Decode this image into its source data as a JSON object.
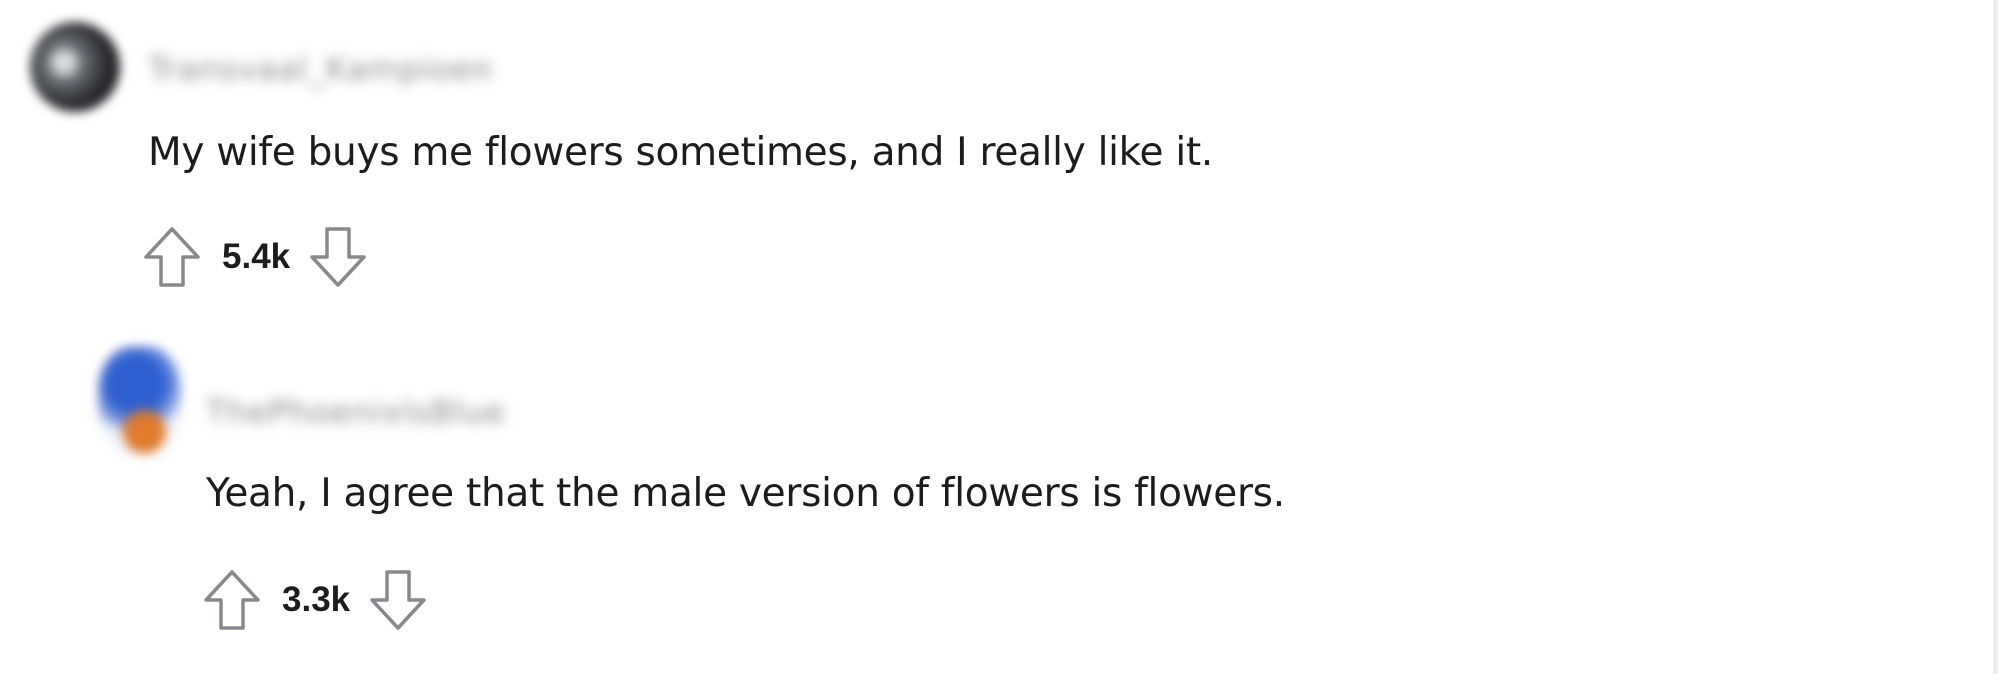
{
  "comments": [
    {
      "username": "Transvaal_Kampioen",
      "body": "My wife buys me flowers sometimes, and I really like it.",
      "score": "5.4k"
    },
    {
      "username": "ThePhoenixIsBlue",
      "body": "Yeah, I agree that the male version of flowers is flowers.",
      "score": "3.3k"
    }
  ],
  "icons": {
    "upvote": "upvote-arrow-icon",
    "downvote": "downvote-arrow-icon"
  },
  "colors": {
    "text": "#1c1c1c",
    "icon_stroke": "#878a8c",
    "background": "#ffffff"
  }
}
